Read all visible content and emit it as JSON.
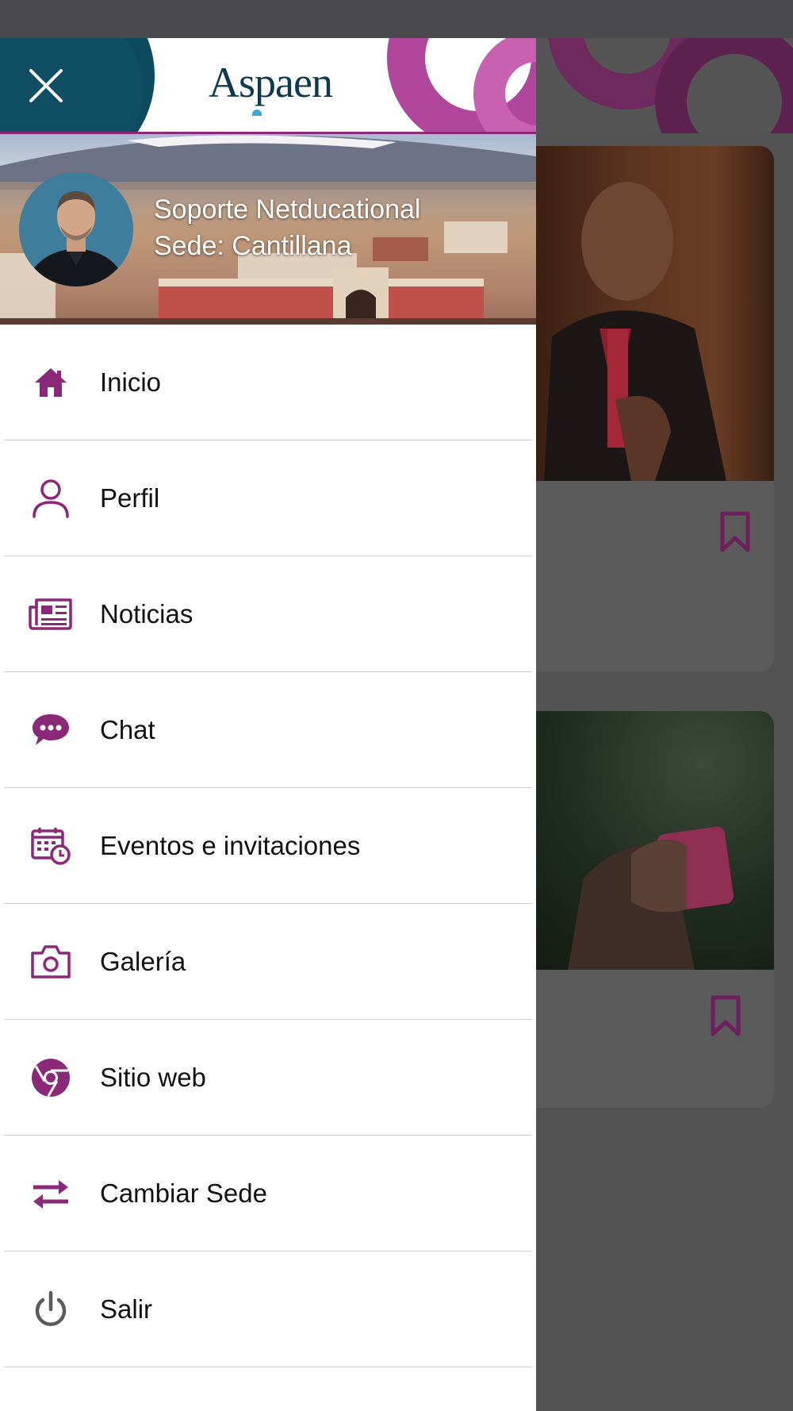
{
  "drawer": {
    "brand": "Aspaen",
    "user": {
      "name": "Soporte Netducational",
      "site": "Sede: Cantillana"
    },
    "menu": [
      {
        "label": "Inicio",
        "icon": "home-icon"
      },
      {
        "label": "Perfil",
        "icon": "user-icon"
      },
      {
        "label": "Noticias",
        "icon": "newspaper-icon"
      },
      {
        "label": "Chat",
        "icon": "chat-icon"
      },
      {
        "label": "Eventos e invitaciones",
        "icon": "calendar-clock-icon"
      },
      {
        "label": "Galería",
        "icon": "camera-icon"
      },
      {
        "label": "Sitio web",
        "icon": "chrome-icon"
      },
      {
        "label": "Cambiar Sede",
        "icon": "swap-icon"
      },
      {
        "label": "Salir",
        "icon": "power-icon"
      }
    ]
  },
  "colors": {
    "accent": "#8b2877",
    "brand_text": "#0e3a4d",
    "brand_dot": "#3ba9d6",
    "header_teal": "#0e4a5f",
    "overlay": "#4a4a4c"
  }
}
